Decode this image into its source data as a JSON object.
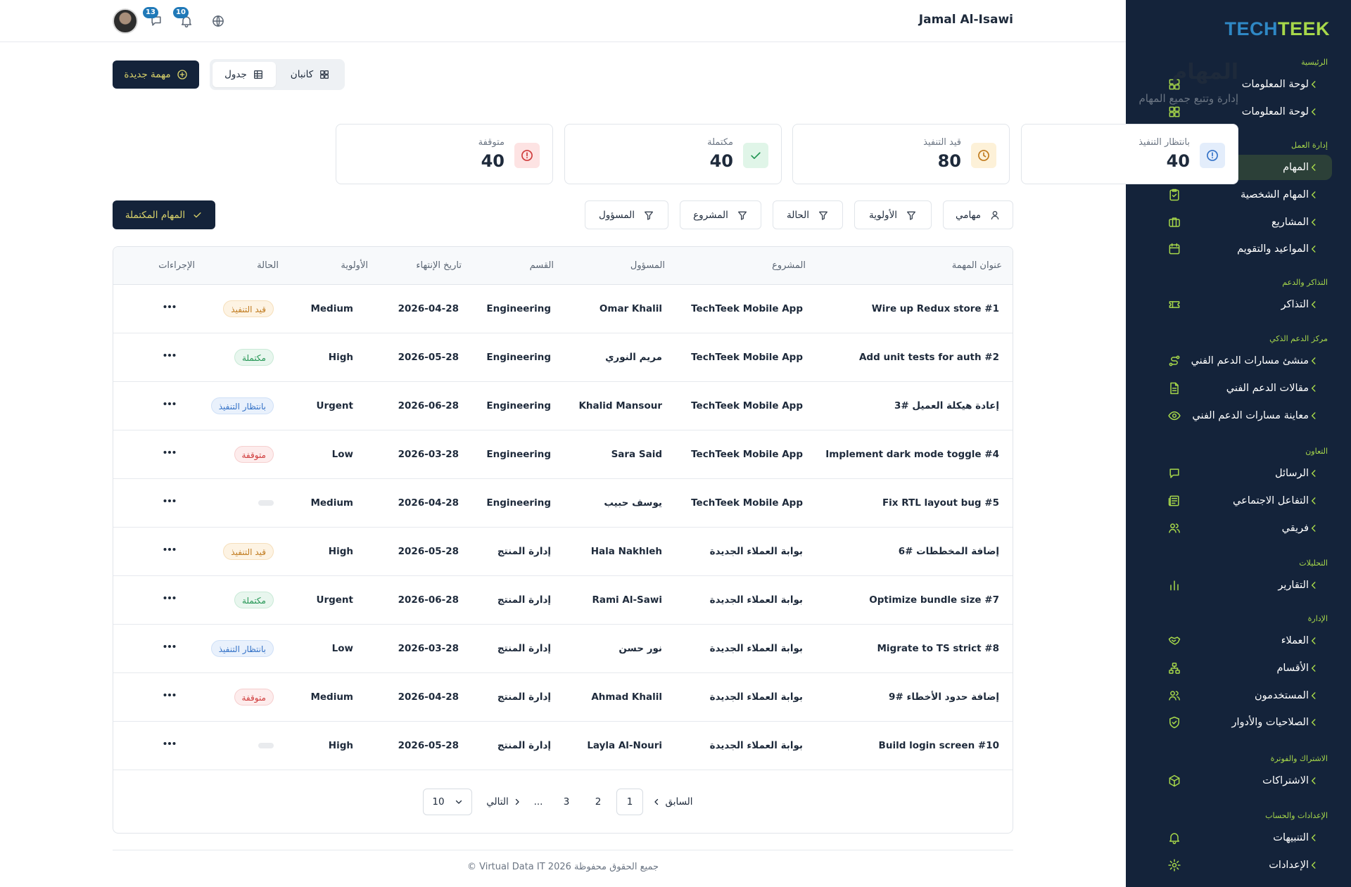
{
  "brand": {
    "part1": "TECH",
    "part2": "TEEK"
  },
  "sidebar": {
    "sections": [
      {
        "title": "الرئيسية",
        "items": [
          {
            "label": "لوحة المعلومات",
            "icon": "dashboard-icon"
          },
          {
            "label": "لوحة المعلومات",
            "icon": "dashboard-icon"
          }
        ]
      },
      {
        "title": "إدارة العمل",
        "items": [
          {
            "label": "المهام",
            "icon": "tasks-icon",
            "active": true
          },
          {
            "label": "المهام الشخصية",
            "icon": "clipboard-check-icon"
          },
          {
            "label": "المشاريع",
            "icon": "briefcase-icon"
          },
          {
            "label": "المواعيد والتقويم",
            "icon": "calendar-icon"
          }
        ]
      },
      {
        "title": "التذاكر والدعم",
        "items": [
          {
            "label": "التذاكر",
            "icon": "ticket-icon"
          }
        ]
      },
      {
        "title": "مركز الدعم الذكي",
        "items": [
          {
            "label": "منشئ مسارات الدعم الفني",
            "icon": "route-icon"
          },
          {
            "label": "مقالات الدعم الفني",
            "icon": "article-icon"
          },
          {
            "label": "معاينة مسارات الدعم الفني",
            "icon": "eye-icon"
          }
        ]
      },
      {
        "title": "التعاون",
        "items": [
          {
            "label": "الرسائل",
            "icon": "message-icon"
          },
          {
            "label": "التفاعل الاجتماعي",
            "icon": "newspaper-icon"
          },
          {
            "label": "فريقي",
            "icon": "team-icon"
          }
        ]
      },
      {
        "title": "التحليلات",
        "items": [
          {
            "label": "التقارير",
            "icon": "bar-chart-icon"
          }
        ]
      },
      {
        "title": "الإدارة",
        "items": [
          {
            "label": "العملاء",
            "icon": "handshake-icon"
          },
          {
            "label": "الأقسام",
            "icon": "org-chart-icon"
          },
          {
            "label": "المستخدمون",
            "icon": "users-icon"
          },
          {
            "label": "الصلاحيات والأدوار",
            "icon": "shield-check-icon"
          }
        ]
      },
      {
        "title": "الاشتراك والفوترة",
        "items": [
          {
            "label": "الاشتراكات",
            "icon": "package-icon"
          }
        ]
      },
      {
        "title": "الإعدادات والحساب",
        "items": [
          {
            "label": "التنبيهات",
            "icon": "bell-icon"
          },
          {
            "label": "الإعدادات",
            "icon": "gear-icon"
          }
        ]
      }
    ]
  },
  "header": {
    "user_name": "Jamal Al-Isawi",
    "messages_count": "13",
    "notifications_count": "10"
  },
  "page": {
    "title": "المهام",
    "subtitle": "إدارة وتتبع جميع المهام",
    "new_task_label": "مهمة جديدة",
    "view_kanban": "كانبان",
    "view_table": "جدول"
  },
  "stats": [
    {
      "label": "بانتظار التنفيذ",
      "value": "40",
      "icon": "clock-alert-icon",
      "color": "#3472c7",
      "bg": "#e3edfb"
    },
    {
      "label": "قيد التنفيذ",
      "value": "80",
      "icon": "clock-icon",
      "color": "#c07a1d",
      "bg": "#fdf1d8"
    },
    {
      "label": "مكتملة",
      "value": "40",
      "icon": "check-icon",
      "color": "#239553",
      "bg": "#e0f5e8"
    },
    {
      "label": "متوقفة",
      "value": "40",
      "icon": "alert-circle-icon",
      "color": "#cf3b3b",
      "bg": "#fde3e3"
    }
  ],
  "filters": {
    "my_tasks": "مهامي",
    "priority": "الأولوية",
    "status": "الحالة",
    "project": "المشروع",
    "assignee": "المسؤول",
    "completed_tasks": "المهام المكتملة"
  },
  "table": {
    "headers": {
      "title": "عنوان المهمة",
      "project": "المشروع",
      "assignee": "المسؤول",
      "department": "القسم",
      "due": "تاريخ الإنتهاء",
      "priority": "الأولوية",
      "status": "الحالة",
      "actions": "الإجراءات"
    },
    "rows": [
      {
        "title": "Wire up Redux store #1",
        "project": "TechTeek Mobile App",
        "assignee": "Omar Khalil",
        "department": "Engineering",
        "due": "2026-04-28",
        "priority": "Medium",
        "status": "قيد التنفيذ",
        "status_type": "progress"
      },
      {
        "title": "Add unit tests for auth #2",
        "project": "TechTeek Mobile App",
        "assignee": "مريم النوري",
        "department": "Engineering",
        "due": "2026-05-28",
        "priority": "High",
        "status": "مكتملة",
        "status_type": "done"
      },
      {
        "title": "إعادة هيكلة العميل #3",
        "project": "TechTeek Mobile App",
        "assignee": "Khalid Mansour",
        "department": "Engineering",
        "due": "2026-06-28",
        "priority": "Urgent",
        "status": "بانتظار التنفيذ",
        "status_type": "pending"
      },
      {
        "title": "Implement dark mode toggle #4",
        "project": "TechTeek Mobile App",
        "assignee": "Sara Said",
        "department": "Engineering",
        "due": "2026-03-28",
        "priority": "Low",
        "status": "متوقفة",
        "status_type": "stopped"
      },
      {
        "title": "Fix RTL layout bug #5",
        "project": "TechTeek Mobile App",
        "assignee": "يوسف حبيب",
        "department": "Engineering",
        "due": "2026-04-28",
        "priority": "Medium",
        "status": "",
        "status_type": "empty"
      },
      {
        "title": "إضافة المخططات #6",
        "project": "بوابة العملاء الجديدة",
        "assignee": "Hala Nakhleh",
        "department": "إدارة المنتج",
        "due": "2026-05-28",
        "priority": "High",
        "status": "قيد التنفيذ",
        "status_type": "progress"
      },
      {
        "title": "Optimize bundle size #7",
        "project": "بوابة العملاء الجديدة",
        "assignee": "Rami Al-Sawi",
        "department": "إدارة المنتج",
        "due": "2026-06-28",
        "priority": "Urgent",
        "status": "مكتملة",
        "status_type": "done"
      },
      {
        "title": "Migrate to TS strict #8",
        "project": "بوابة العملاء الجديدة",
        "assignee": "نور حسن",
        "department": "إدارة المنتج",
        "due": "2026-03-28",
        "priority": "Low",
        "status": "بانتظار التنفيذ",
        "status_type": "pending"
      },
      {
        "title": "إضافة حدود الأخطاء #9",
        "project": "بوابة العملاء الجديدة",
        "assignee": "Ahmad Khalil",
        "department": "إدارة المنتج",
        "due": "2026-04-28",
        "priority": "Medium",
        "status": "متوقفة",
        "status_type": "stopped"
      },
      {
        "title": "Build login screen #10",
        "project": "بوابة العملاء الجديدة",
        "assignee": "Layla Al-Nouri",
        "department": "إدارة المنتج",
        "due": "2026-05-28",
        "priority": "High",
        "status": "",
        "status_type": "empty"
      }
    ]
  },
  "pagination": {
    "prev": "السابق",
    "next": "التالي",
    "pages": [
      "1",
      "2",
      "3"
    ],
    "current": "1",
    "ellipsis": "...",
    "page_size": "10"
  },
  "footer": {
    "text": "© Virtual Data IT 2026 جميع الحقوق محفوظة"
  }
}
